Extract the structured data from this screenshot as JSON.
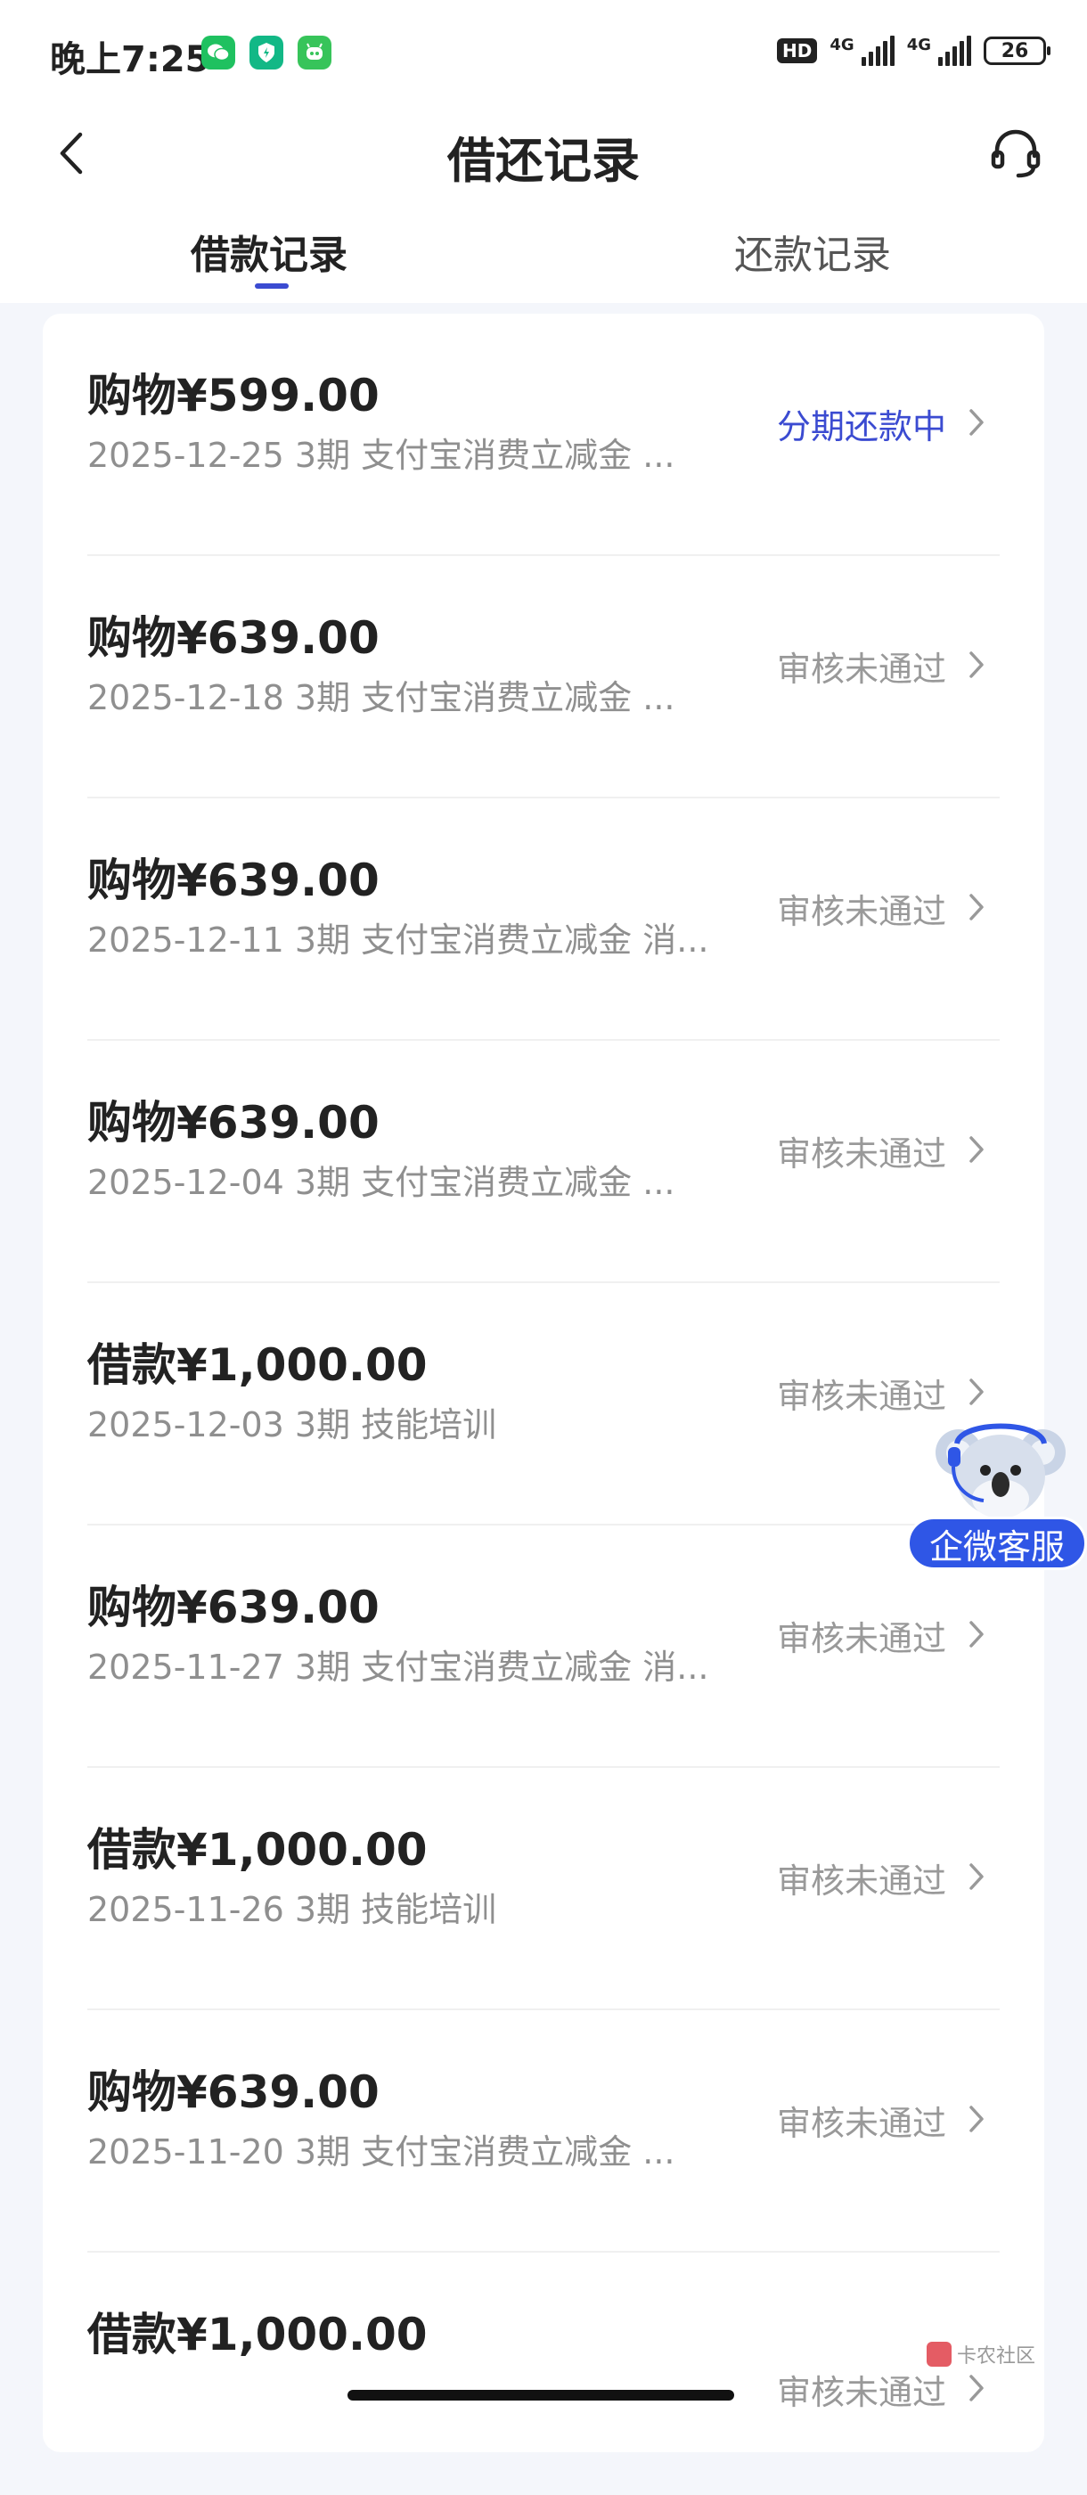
{
  "status_bar": {
    "time": "晚上7:25",
    "apps": [
      "wechat-icon",
      "shield-app-icon",
      "bot-app-icon"
    ],
    "hd_label": "HD",
    "network_1": "4G",
    "network_2": "4G",
    "battery": "26"
  },
  "header": {
    "title": "借还记录",
    "tabs": [
      {
        "label": "借款记录",
        "active": true
      },
      {
        "label": "还款记录",
        "active": false
      }
    ]
  },
  "colors": {
    "accent": "#3b4bd1",
    "status_gray": "#999999",
    "support_blue": "#2f56e6"
  },
  "records": [
    {
      "title": "购物¥599.00",
      "subtitle": "2025-12-25 3期  支付宝消费立减金 ...",
      "status": "分期还款中",
      "status_type": "active"
    },
    {
      "title": "购物¥639.00",
      "subtitle": "2025-12-18 3期  支付宝消费立减金 ...",
      "status": "审核未通过",
      "status_type": "rejected"
    },
    {
      "title": "购物¥639.00",
      "subtitle": "2025-12-11 3期  支付宝消费立减金 消...",
      "status": "审核未通过",
      "status_type": "rejected"
    },
    {
      "title": "购物¥639.00",
      "subtitle": "2025-12-04 3期  支付宝消费立减金 ...",
      "status": "审核未通过",
      "status_type": "rejected"
    },
    {
      "title": "借款¥1,000.00",
      "subtitle": "2025-12-03 3期  技能培训",
      "status": "审核未通过",
      "status_type": "rejected"
    },
    {
      "title": "购物¥639.00",
      "subtitle": "2025-11-27 3期  支付宝消费立减金 消...",
      "status": "审核未通过",
      "status_type": "rejected"
    },
    {
      "title": "借款¥1,000.00",
      "subtitle": "2025-11-26 3期  技能培训",
      "status": "审核未通过",
      "status_type": "rejected"
    },
    {
      "title": "购物¥639.00",
      "subtitle": "2025-11-20 3期  支付宝消费立减金 ...",
      "status": "审核未通过",
      "status_type": "rejected"
    },
    {
      "title": "借款¥1,000.00",
      "subtitle": "",
      "status": "审核未通过",
      "status_type": "rejected"
    }
  ],
  "floating_support": {
    "label": "企微客服",
    "icon": "koala-mascot-icon"
  },
  "watermark": {
    "text": "卡农社区"
  }
}
